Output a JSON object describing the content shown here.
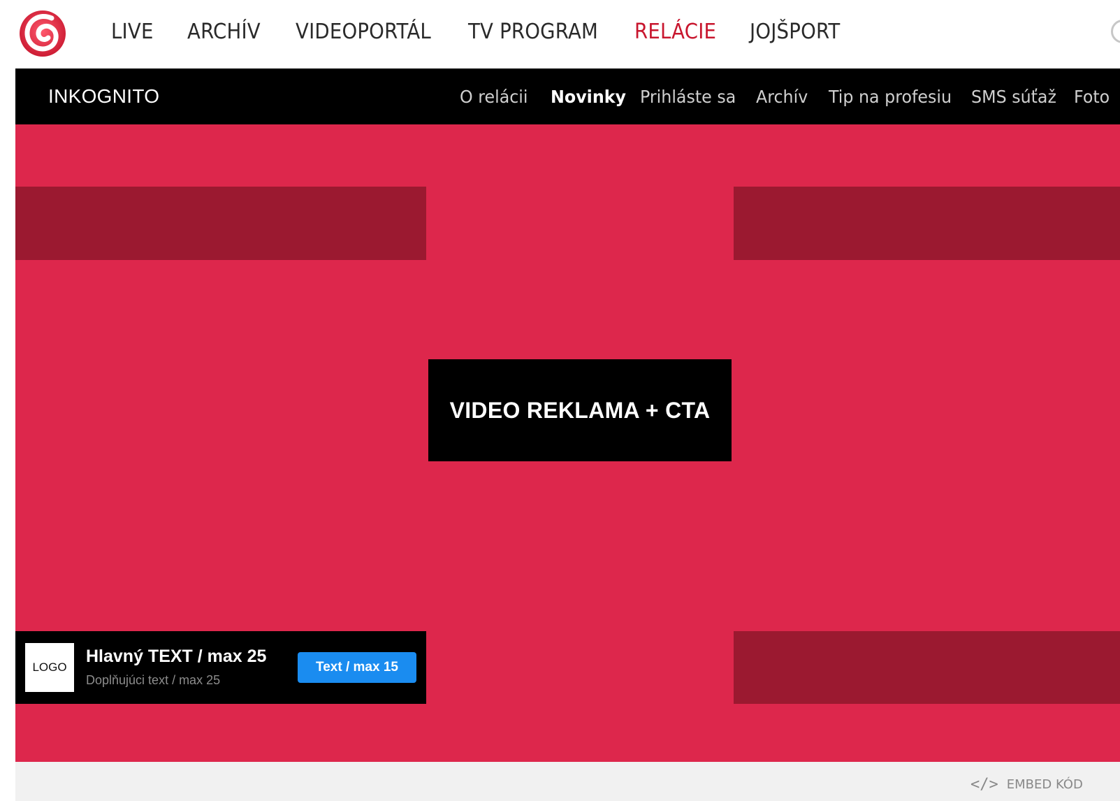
{
  "topnav": {
    "items": [
      {
        "label": "LIVE"
      },
      {
        "label": "ARCHÍV"
      },
      {
        "label": "VIDEOPORTÁL"
      },
      {
        "label": "TV PROGRAM"
      },
      {
        "label": "RELÁCIE",
        "active": true
      },
      {
        "label": "JOJŠPORT"
      }
    ]
  },
  "show": {
    "title": "INKOGNITO",
    "tabs": [
      {
        "label": "O relácii"
      },
      {
        "label": "Novinky",
        "active": true
      },
      {
        "label": "Prihláste sa"
      },
      {
        "label": "Archív"
      },
      {
        "label": "Tip na profesiu"
      },
      {
        "label": "SMS súťaž"
      },
      {
        "label": "Foto"
      }
    ]
  },
  "ad": {
    "video_label": "VIDEO REKLAMA + CTA",
    "banner": {
      "logo": "LOGO",
      "main_text": "Hlavný TEXT / max 25",
      "sub_text": "Doplňujúci text / max 25",
      "cta": "Text / max 15"
    }
  },
  "footer": {
    "embed_icon": "code-icon",
    "embed_label": "EMBED KÓD"
  },
  "colors": {
    "brand_red": "#c8162e",
    "ad_background": "#dd274c",
    "ad_dark_block": "#9b1930",
    "cta_blue": "#1a8cf0"
  }
}
